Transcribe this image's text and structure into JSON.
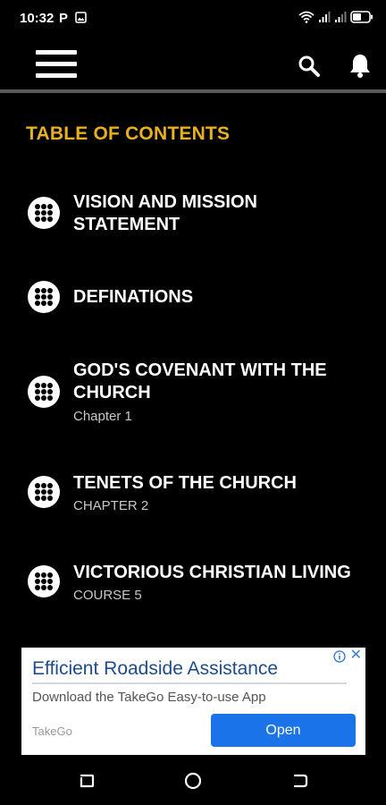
{
  "status_bar": {
    "time": "10:32",
    "p_indicator": "P",
    "icons": [
      "image-icon",
      "wifi-icon",
      "signal-icon",
      "signal-icon",
      "battery-icon"
    ]
  },
  "app_bar": {
    "icons": [
      "menu-icon",
      "search-icon",
      "bell-icon"
    ]
  },
  "toc": {
    "heading": "TABLE OF CONTENTS",
    "heading_color": "#e8b020",
    "items": [
      {
        "title": "VISION AND MISSION STATEMENT",
        "subtitle": ""
      },
      {
        "title": "DEFINATIONS",
        "subtitle": ""
      },
      {
        "title": "GOD'S COVENANT WITH THE CHURCH",
        "subtitle": "Chapter 1"
      },
      {
        "title": "TENETS OF THE CHURCH",
        "subtitle": "CHAPTER 2"
      },
      {
        "title": "VICTORIOUS CHRISTIAN LIVING",
        "subtitle": "COURSE 5"
      }
    ]
  },
  "ad": {
    "title": "Efficient Roadside Assistance",
    "description": "Download the TakeGo Easy-to-use App",
    "advertiser": "TakeGo",
    "cta": "Open",
    "close": "✕",
    "cta_color": "#1a73e8"
  },
  "nav_bar": {
    "buttons": [
      "recents-icon",
      "home-icon",
      "back-icon"
    ]
  }
}
